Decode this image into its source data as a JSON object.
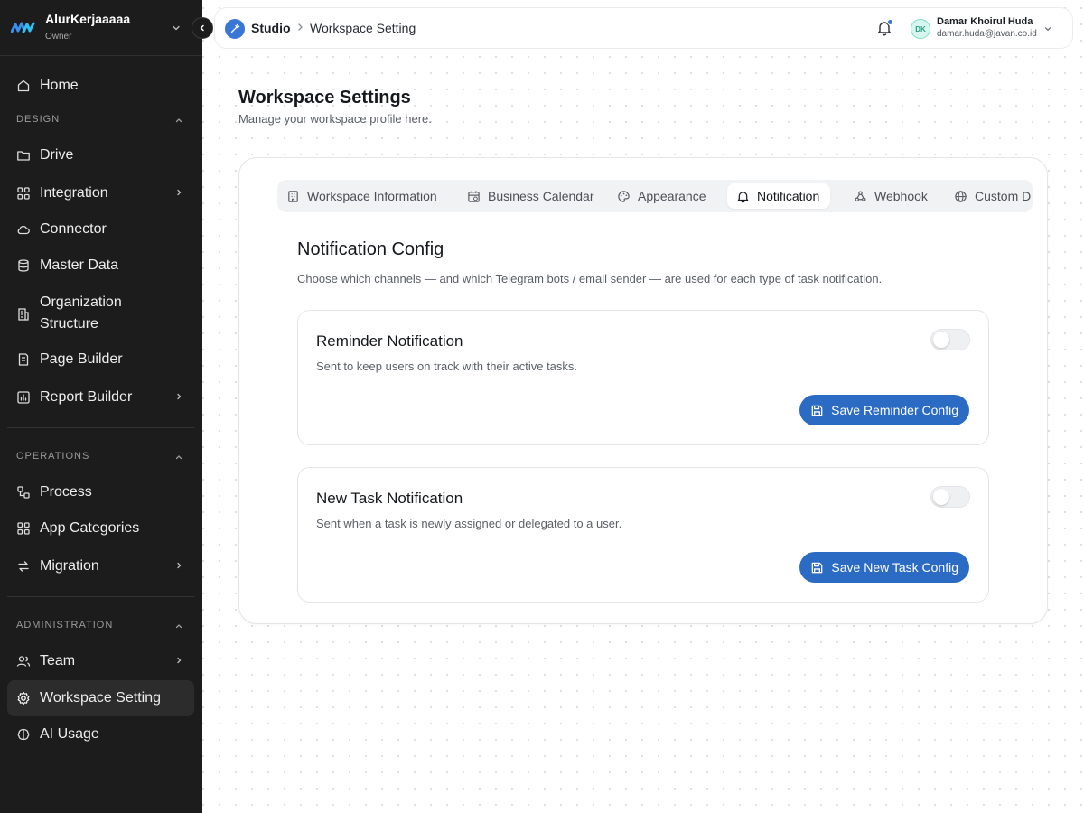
{
  "workspace": {
    "name": "AlurKerjaaaaa",
    "role": "Owner"
  },
  "sidebar": {
    "home": "Home",
    "sections": [
      {
        "title": "DESIGN",
        "items": [
          "Drive",
          "Integration",
          "Connector",
          "Master Data",
          "Organization Structure",
          "Page Builder",
          "Report Builder"
        ]
      },
      {
        "title": "OPERATIONS",
        "items": [
          "Process",
          "App Categories",
          "Migration"
        ]
      },
      {
        "title": "ADMINISTRATION",
        "items": [
          "Team",
          "Workspace Setting",
          "AI Usage"
        ]
      }
    ],
    "active": "Workspace Setting"
  },
  "topbar": {
    "app": "Studio",
    "page": "Workspace Setting",
    "user": {
      "initials": "DK",
      "name": "Damar Khoirul Huda",
      "email": "damar.huda@javan.co.id"
    }
  },
  "page": {
    "title": "Workspace Settings",
    "subtitle": "Manage your workspace profile here."
  },
  "tabs": [
    {
      "label": "Workspace Information",
      "icon": "building-icon"
    },
    {
      "label": "Business Calendar",
      "icon": "calendar-clock-icon"
    },
    {
      "label": "Appearance",
      "icon": "palette-icon"
    },
    {
      "label": "Notification",
      "icon": "bell-icon"
    },
    {
      "label": "Webhook",
      "icon": "webhook-icon"
    },
    {
      "label": "Custom D",
      "icon": "globe-icon"
    }
  ],
  "active_tab": "Notification",
  "config": {
    "title": "Notification Config",
    "description": "Choose which channels — and which Telegram bots / email sender — are used for each type of task notification.",
    "cards": [
      {
        "title": "Reminder Notification",
        "description": "Sent to keep users on track with their active tasks.",
        "enabled": false,
        "button": "Save Reminder Config"
      },
      {
        "title": "New Task Notification",
        "description": "Sent when a task is newly assigned or delegated to a user.",
        "enabled": false,
        "button": "Save New Task Config"
      }
    ]
  },
  "colors": {
    "sidebar_bg": "#1c1c1c",
    "accent": "#2c6bc4",
    "avatar_bg": "#d6f6ef"
  }
}
